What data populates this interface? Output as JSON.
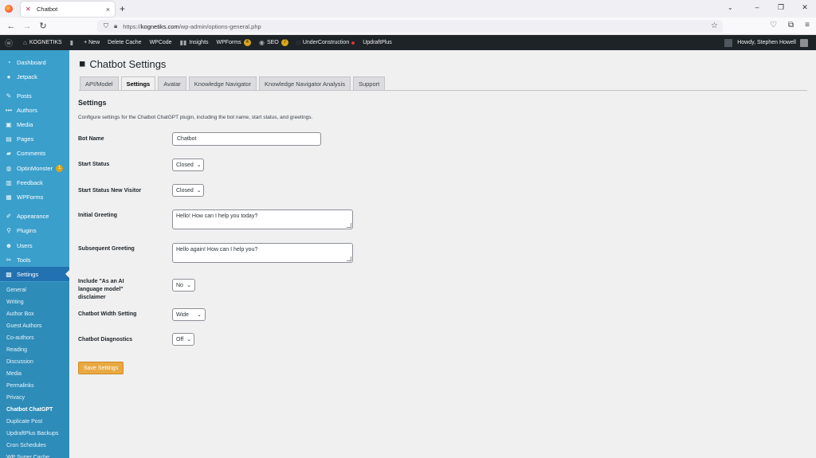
{
  "browser": {
    "tab_title": "Chatbot",
    "url_prefix": "https://",
    "url_host": "kognetiks.com",
    "url_path": "/wp-admin/options-general.php"
  },
  "adminbar": {
    "site": "KOGNETIKS",
    "new": "+ New",
    "delete_cache": "Delete Cache",
    "wpcode": "WPCode",
    "insights": "Insights",
    "wpforms": "WPForms",
    "wpforms_badge": "4",
    "seo": "SEO",
    "seo_badge": "7",
    "under_construction": "UnderConstruction",
    "updraftplus": "UpdraftPlus",
    "howdy": "Howdy, Stephen Howell"
  },
  "sidebar": {
    "items": [
      {
        "label": "Dashboard",
        "icon": "dashboard-icon"
      },
      {
        "label": "Jetpack",
        "icon": "jetpack-icon"
      },
      {
        "label": "Posts",
        "icon": "pin-icon"
      },
      {
        "label": "Authors",
        "icon": "dots-icon"
      },
      {
        "label": "Media",
        "icon": "media-icon"
      },
      {
        "label": "Pages",
        "icon": "page-icon"
      },
      {
        "label": "Comments",
        "icon": "comment-icon"
      },
      {
        "label": "OptinMonster",
        "icon": "optinmonster-icon",
        "badge": "1"
      },
      {
        "label": "Feedback",
        "icon": "feedback-icon"
      },
      {
        "label": "WPForms",
        "icon": "forms-icon"
      },
      {
        "label": "Appearance",
        "icon": "brush-icon"
      },
      {
        "label": "Plugins",
        "icon": "plugin-icon"
      },
      {
        "label": "Users",
        "icon": "user-icon"
      },
      {
        "label": "Tools",
        "icon": "wrench-icon"
      },
      {
        "label": "Settings",
        "icon": "settings-icon"
      }
    ],
    "submenu": [
      "General",
      "Writing",
      "Author Box",
      "Guest Authors",
      "Co-authors",
      "Reading",
      "Discussion",
      "Media",
      "Permalinks",
      "Privacy",
      "Chatbot ChatGPT",
      "Duplicate Post",
      "UpdraftPlus Backups",
      "Cron Schedules",
      "WP Super Cache"
    ]
  },
  "page": {
    "title": "Chatbot Settings",
    "tabs": [
      "API/Model",
      "Settings",
      "Avatar",
      "Knowledge Navigator",
      "Knowledge Navigator Analysis",
      "Support"
    ],
    "active_tab": "Settings",
    "section_heading": "Settings",
    "description": "Configure settings for the Chatbot ChatGPT plugin, including the bot name, start status, and greetings."
  },
  "form": {
    "bot_name_label": "Bot Name",
    "bot_name_value": "Chatbot",
    "start_status_label": "Start Status",
    "start_status_value": "Closed",
    "start_status_new_label": "Start Status New Visitor",
    "start_status_new_value": "Closed",
    "initial_greeting_label": "Initial Greeting",
    "initial_greeting_value": "Hello! How can I help you today?",
    "subsequent_greeting_label": "Subsequent Greeting",
    "subsequent_greeting_value": "Hello again! How can I help you?",
    "disclaimer_label": "Include \"As an AI language model\" disclaimer",
    "disclaimer_value": "No",
    "width_label": "Chatbot Width Setting",
    "width_value": "Wide",
    "diagnostics_label": "Chatbot Diagnostics",
    "diagnostics_value": "Off",
    "save_label": "Save Settings"
  }
}
